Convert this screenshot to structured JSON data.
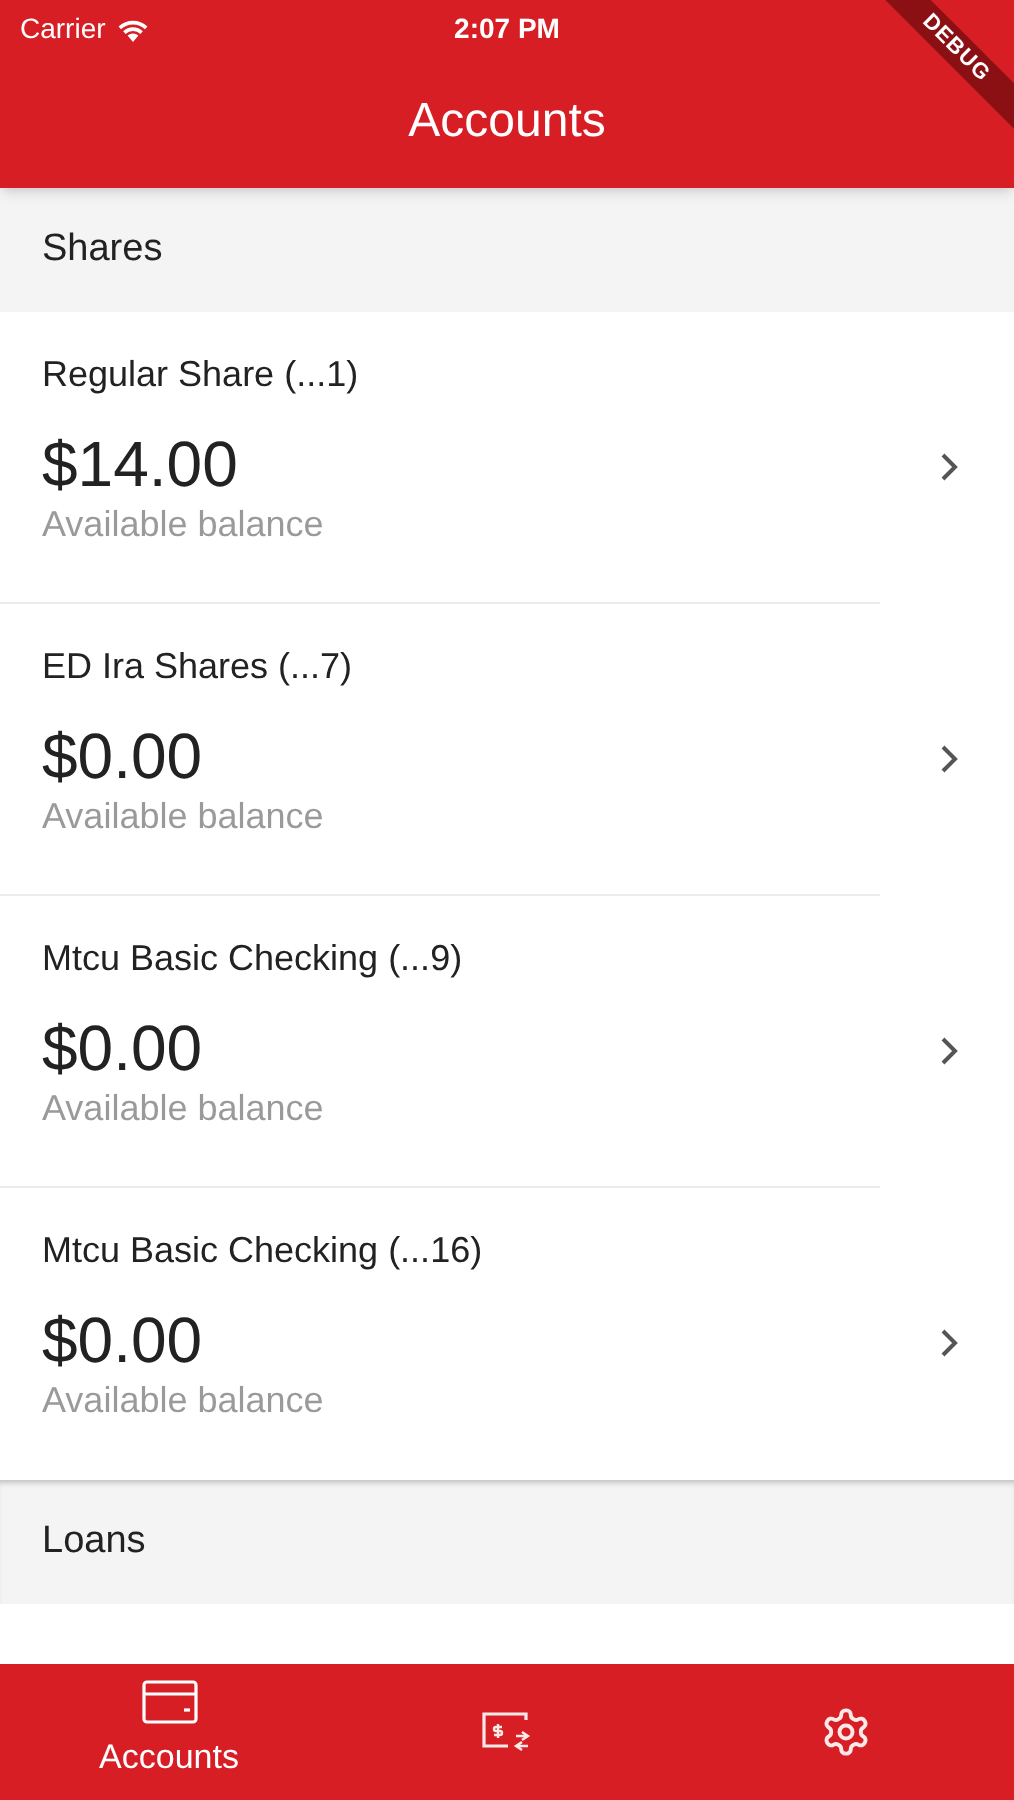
{
  "status_bar": {
    "carrier": "Carrier",
    "time": "2:07 PM"
  },
  "debug_banner": "DEBUG",
  "header": {
    "title": "Accounts"
  },
  "sections": [
    {
      "title": "Shares",
      "accounts": [
        {
          "name": "Regular Share (...1)",
          "amount": "$14.00",
          "caption": "Available balance"
        },
        {
          "name": "ED Ira Shares (...7)",
          "amount": "$0.00",
          "caption": "Available balance"
        },
        {
          "name": "Mtcu Basic Checking (...9)",
          "amount": "$0.00",
          "caption": "Available balance"
        },
        {
          "name": "Mtcu Basic Checking (...16)",
          "amount": "$0.00",
          "caption": "Available balance"
        }
      ]
    },
    {
      "title": "Loans"
    }
  ],
  "tab_bar": [
    {
      "kind": "card",
      "label": "Accounts",
      "selected": true
    },
    {
      "kind": "transfer",
      "selected": false
    },
    {
      "kind": "settings",
      "selected": false
    }
  ]
}
